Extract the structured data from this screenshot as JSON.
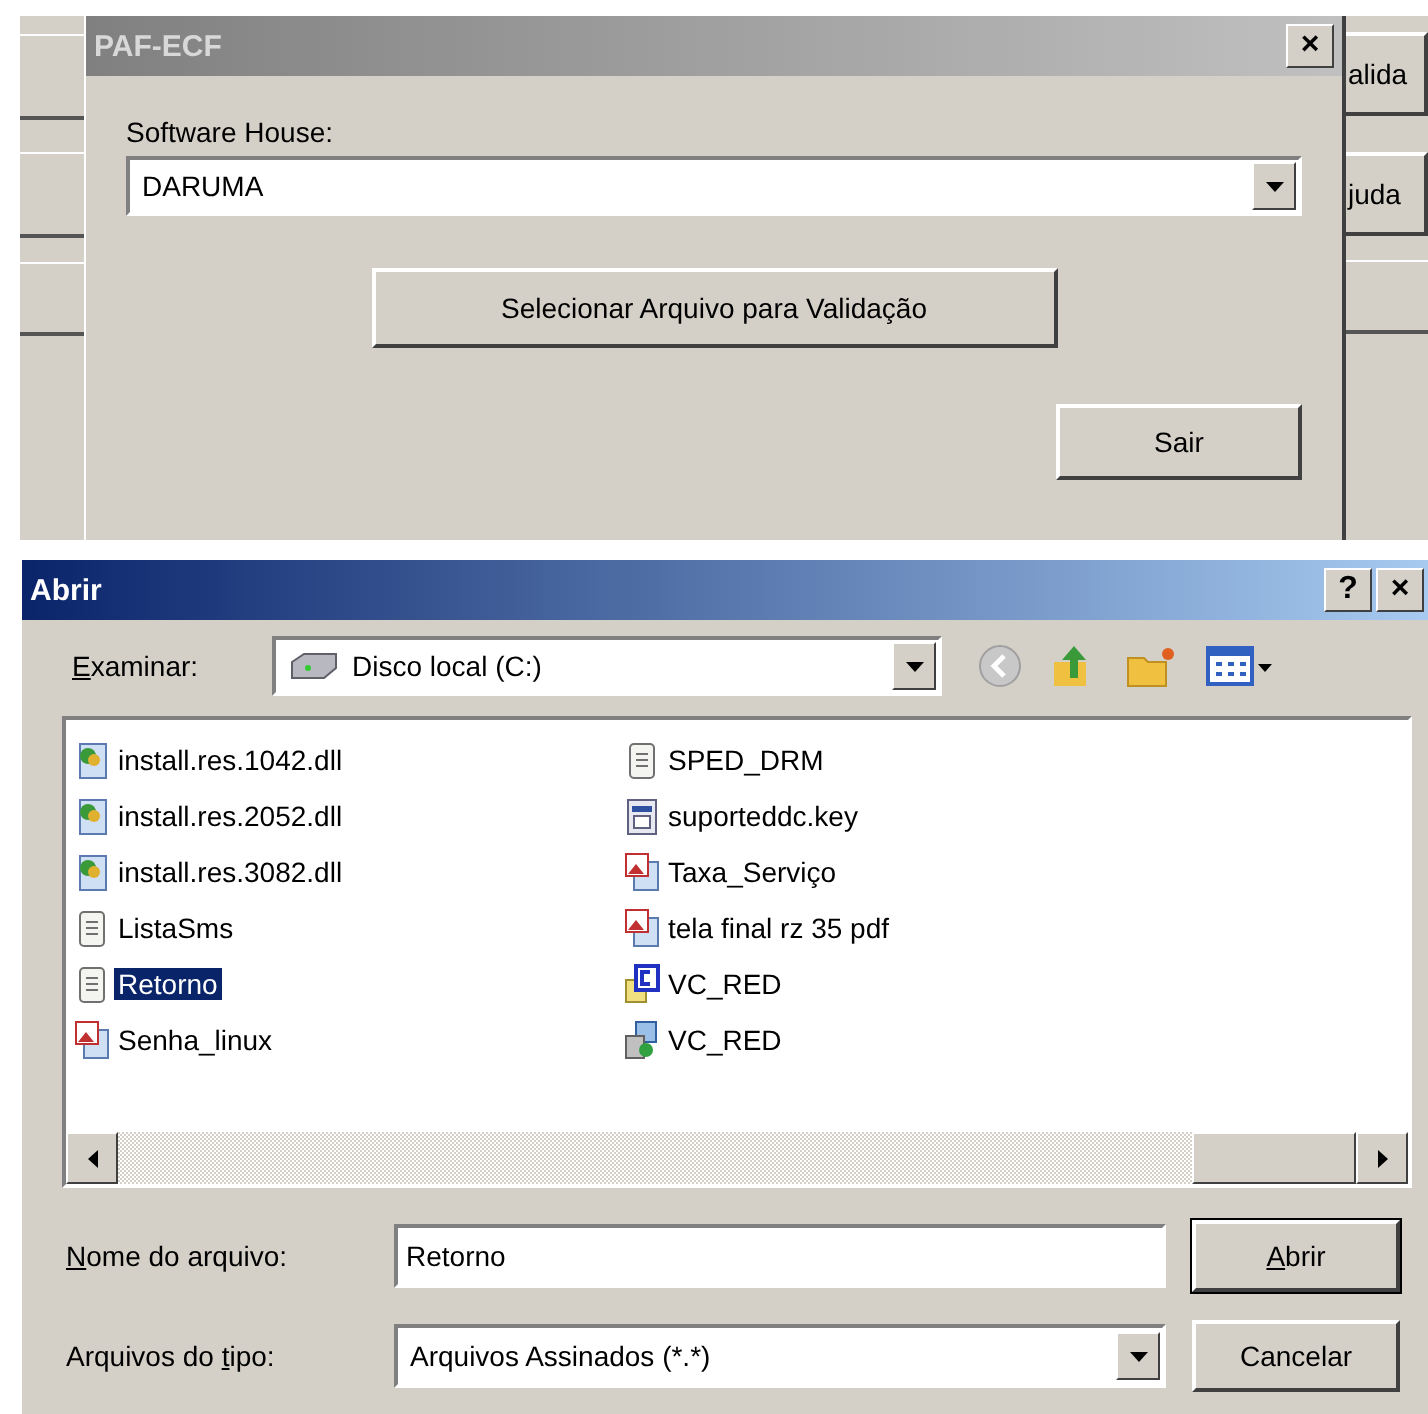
{
  "background_window": {
    "side_buttons": [
      "alida",
      "juda"
    ]
  },
  "paf_dialog": {
    "title": "PAF-ECF",
    "close_button": "×",
    "software_house_label": "Software House:",
    "software_house_value": "DARUMA",
    "select_button": "Selecionar Arquivo para Validação",
    "exit_button": "Sair"
  },
  "open_dialog": {
    "title": "Abrir",
    "help_button": "?",
    "close_button": "×",
    "look_in": {
      "label": {
        "key": "E",
        "after": "xaminar:"
      },
      "value": "Disco local (C:)"
    },
    "files": [
      {
        "name": "install.res.1042.dll",
        "kind": "dll",
        "selected": false
      },
      {
        "name": "install.res.2052.dll",
        "kind": "dll",
        "selected": false
      },
      {
        "name": "install.res.3082.dll",
        "kind": "dll",
        "selected": false
      },
      {
        "name": "ListaSms",
        "kind": "text",
        "selected": false
      },
      {
        "name": "Retorno",
        "kind": "text",
        "selected": true
      },
      {
        "name": "Senha_linux",
        "kind": "image",
        "selected": false
      },
      {
        "name": "SPED_DRM",
        "kind": "text",
        "selected": false
      },
      {
        "name": "suporteddc.key",
        "kind": "key",
        "selected": false
      },
      {
        "name": "Taxa_Serviço",
        "kind": "image",
        "selected": false
      },
      {
        "name": "tela final rz 35 pdf",
        "kind": "image",
        "selected": false
      },
      {
        "name": "VC_RED",
        "kind": "vc",
        "selected": false
      },
      {
        "name": "VC_RED",
        "kind": "setup",
        "selected": false
      }
    ],
    "file_name": {
      "label": {
        "key": "N",
        "after": "ome do arquivo:"
      },
      "value": "Retorno"
    },
    "file_type": {
      "label": {
        "before": "Arquivos do ",
        "key": "t",
        "after": "ipo:"
      },
      "value": "Arquivos Assinados (*.*)"
    },
    "open_button": {
      "key": "A",
      "after": "brir"
    },
    "cancel_button": "Cancelar"
  }
}
